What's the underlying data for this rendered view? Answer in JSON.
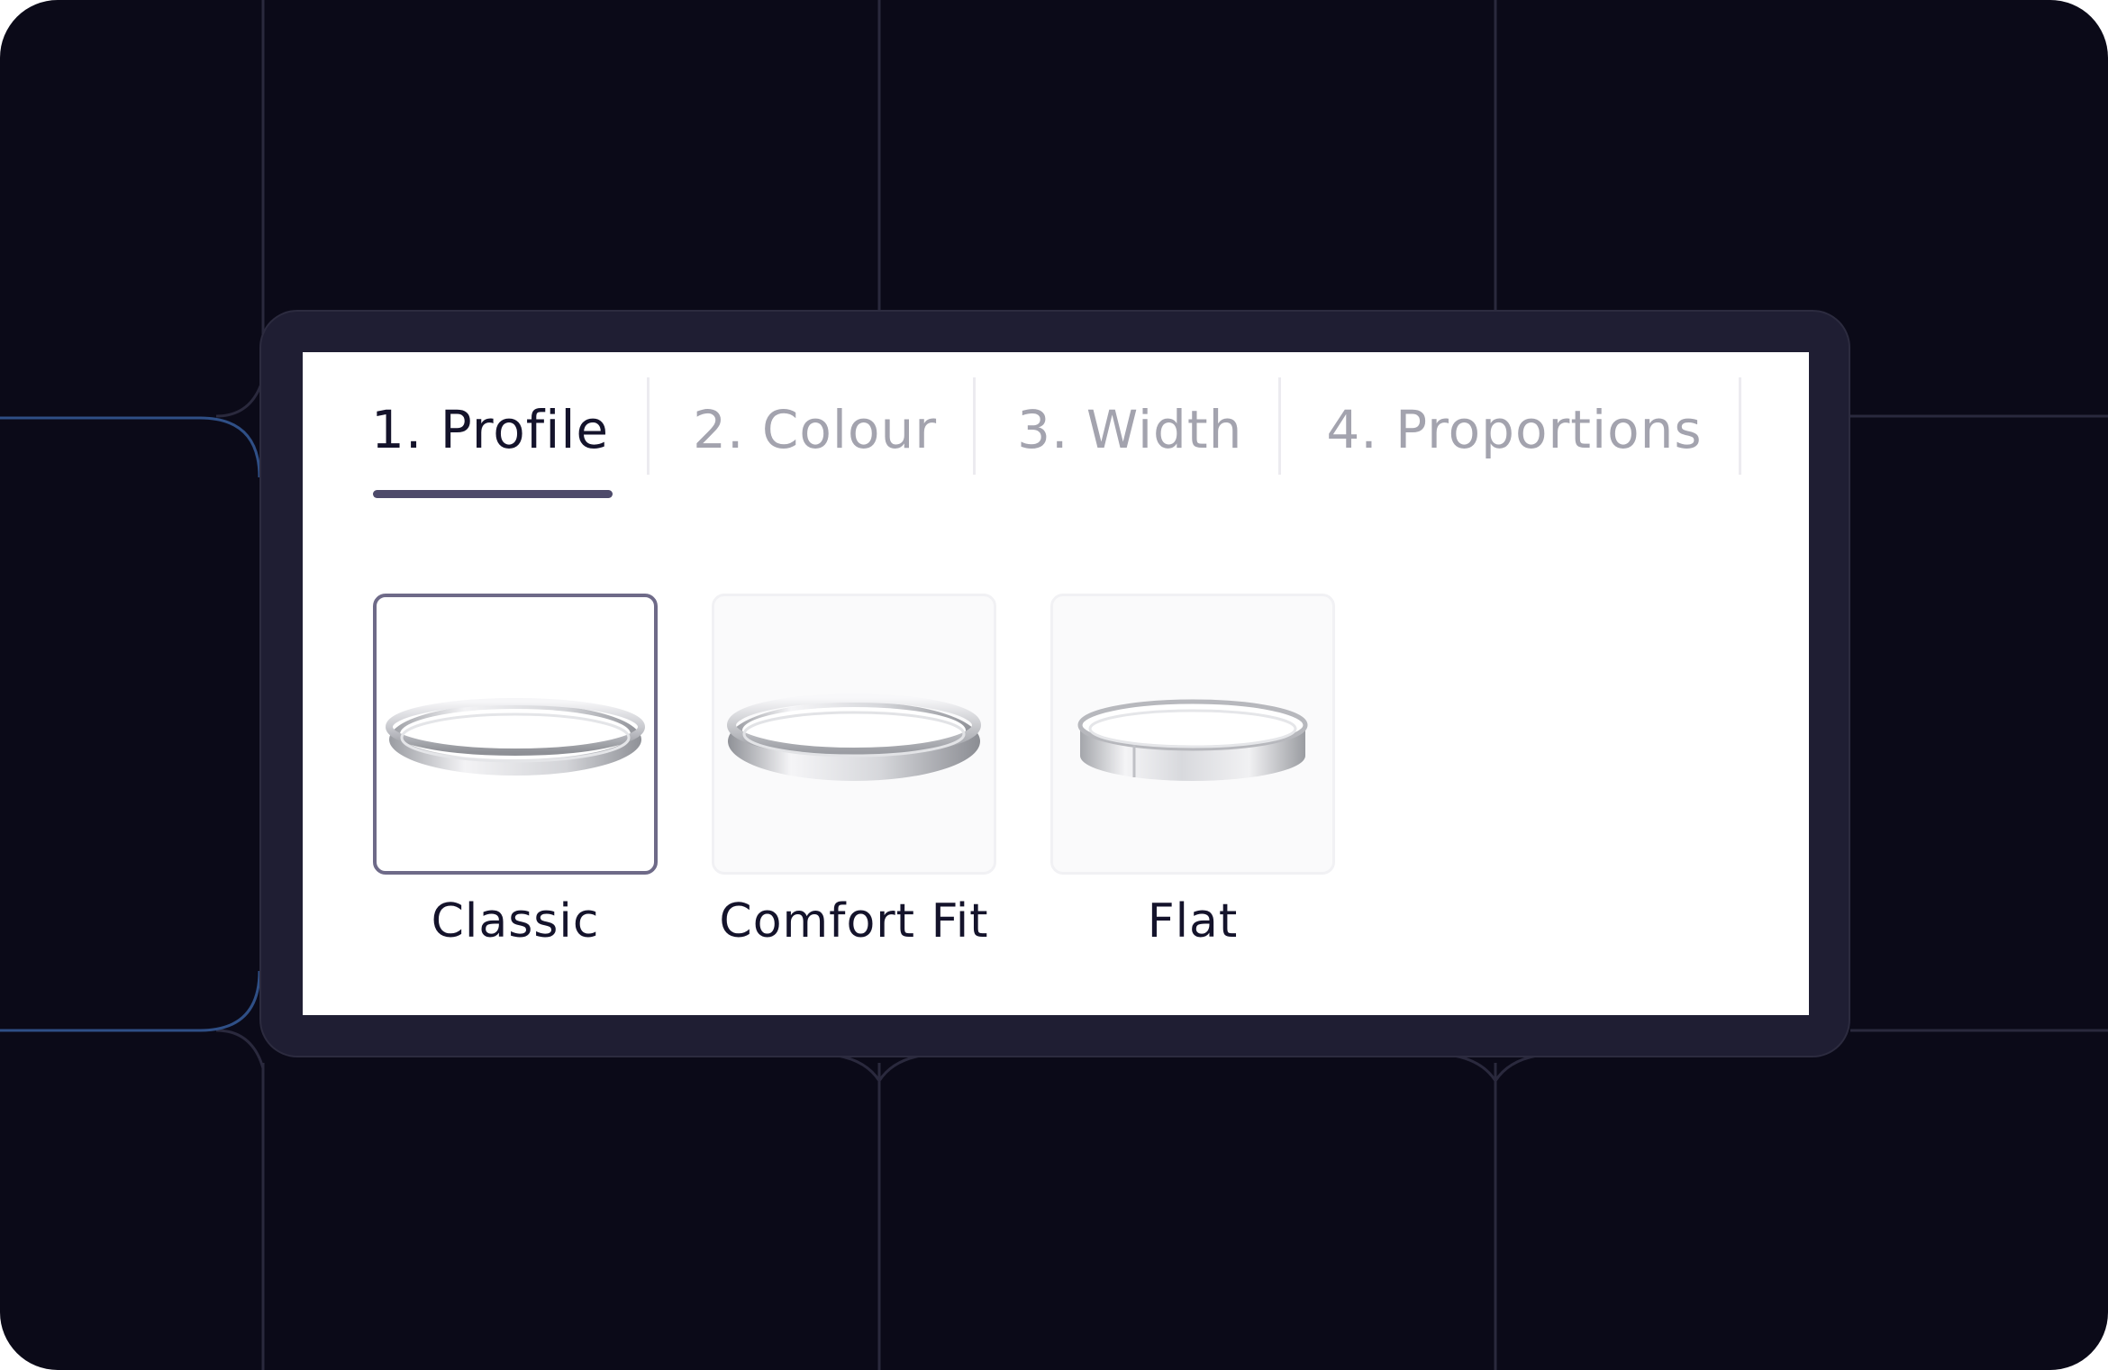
{
  "steps": [
    {
      "label": "1. Profile",
      "active": true
    },
    {
      "label": "2. Colour",
      "active": false
    },
    {
      "label": "3. Width",
      "active": false
    },
    {
      "label": "4. Proportions",
      "active": false
    }
  ],
  "profiles": [
    {
      "label": "Classic",
      "selected": true,
      "image": "ring-classic-icon"
    },
    {
      "label": "Comfort Fit",
      "selected": false,
      "image": "ring-comfort-fit-icon"
    },
    {
      "label": "Flat",
      "selected": false,
      "image": "ring-flat-icon"
    }
  ],
  "colors": {
    "background": "#0b0a18",
    "frame": "#1f1e33",
    "panel": "#ffffff",
    "active_text": "#14132b",
    "inactive_text": "#a3a3ae",
    "underline": "#4d4a6a",
    "selected_border": "#6e6a88",
    "accent_line": "#2f4f86"
  }
}
